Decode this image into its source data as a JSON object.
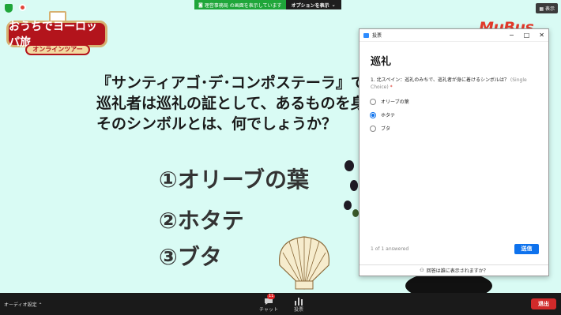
{
  "share_banner": {
    "sharing_text": "理営事務局 の画面を表示しています",
    "options_label": "オプションを表示"
  },
  "view_button": "表示",
  "logo": {
    "title": "おうちでヨーロッパ旅",
    "subtitle": "オンラインツアー"
  },
  "brand": "MuBus",
  "slide": {
    "question_lines": [
      "『サンティアゴ･デ･コンポステーラ』で、",
      "巡礼者は巡礼の証として、あるものを身に",
      "そのシンボルとは、何でしょうか？"
    ],
    "options": [
      "①オリーブの葉",
      "②ホタテ",
      "③ブタ"
    ]
  },
  "poll": {
    "window_title": "投票",
    "title": "巡礼",
    "question": "1. 北スペイン：巡礼のみちで、巡礼者が身に着けるシンボルは？",
    "question_type": "(Single Choice)",
    "required_mark": "*",
    "choices": [
      {
        "label": "オリーブの葉",
        "selected": false
      },
      {
        "label": "ホタテ",
        "selected": true
      },
      {
        "label": "ブタ",
        "selected": false
      }
    ],
    "answered": "1 of 1 answered",
    "submit_label": "送信",
    "footer_text": "回答は誰に表示されますか？"
  },
  "toolbar": {
    "audio_label": "オーディオ設定",
    "chat_label": "チャット",
    "chat_badge": "11",
    "poll_label": "投票",
    "leave_label": "退出"
  },
  "colors": {
    "slide_bg": "#d9fbf4",
    "accent_blue": "#0e72ed",
    "leave_red": "#d12a2a",
    "share_green": "#1fa63a"
  }
}
